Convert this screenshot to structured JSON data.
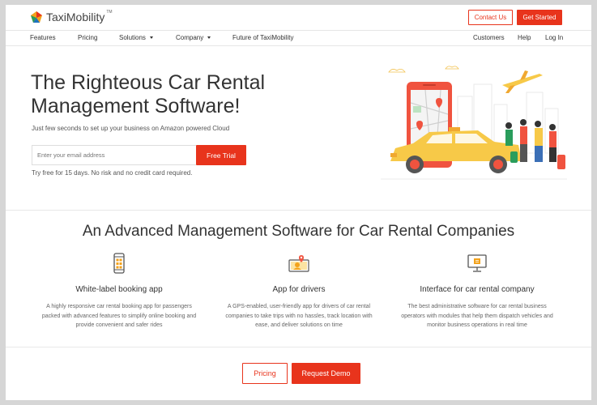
{
  "header": {
    "brand": "TaxiMobility",
    "brand_tm": "TM",
    "contact_label": "Contact Us",
    "get_started_label": "Get Started"
  },
  "nav": {
    "left": [
      "Features",
      "Pricing",
      "Solutions",
      "Company",
      "Future of TaxiMobility"
    ],
    "right": [
      "Customers",
      "Help",
      "Log In"
    ]
  },
  "hero": {
    "title": "The Righteous Car Rental Management Software!",
    "subtitle": "Just few seconds to set up your business on Amazon powered Cloud",
    "email_placeholder": "Enter your email address",
    "trial_label": "Free Trial",
    "trial_note": "Try free for 15 days. No risk and no credit card required."
  },
  "features": {
    "title": "An Advanced Management Software for Car Rental Companies",
    "items": [
      {
        "icon": "mobile-app-icon",
        "title": "White-label booking app",
        "desc": "A highly responsive car rental booking app for passengers packed with advanced features to simplify online booking and provide convenient and safer rides"
      },
      {
        "icon": "driver-app-icon",
        "title": "App for drivers",
        "desc": "A GPS-enabled, user-friendly app for drivers of car rental companies to take trips with no hassles, track location with ease, and deliver solutions on time"
      },
      {
        "icon": "admin-dashboard-icon",
        "title": "Interface for car rental company",
        "desc": "The best administrative software for car rental business operators with modules that help them dispatch vehicles and monitor business operations in real time"
      }
    ]
  },
  "cta": {
    "pricing_label": "Pricing",
    "demo_label": "Request Demo"
  },
  "colors": {
    "accent": "#e8341c",
    "taxi_yellow": "#f7c948",
    "phone_red": "#f0533f"
  }
}
